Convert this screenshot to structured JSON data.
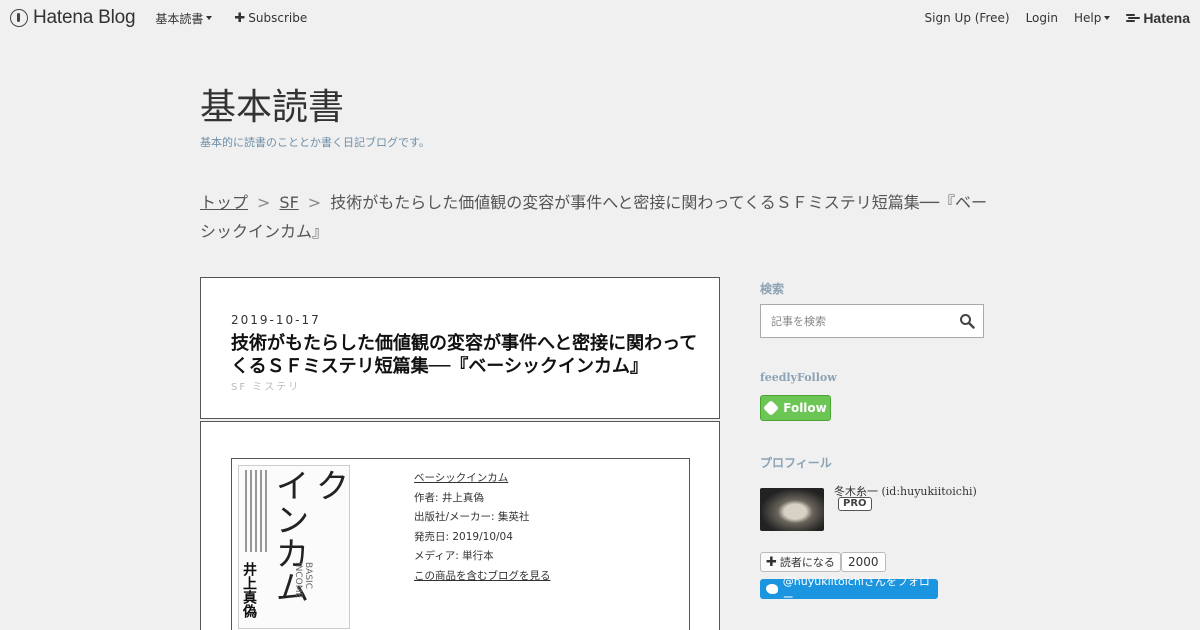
{
  "topbar": {
    "brand": "Hatena Blog",
    "nav": [
      {
        "label": "基本読書",
        "has_caret": true
      },
      {
        "label": "Subscribe",
        "has_plus": true
      }
    ],
    "right": {
      "signup": "Sign Up (Free)",
      "login": "Login",
      "help": "Help",
      "hatena": "Hatena"
    }
  },
  "blog": {
    "title": "基本読書",
    "description": "基本的に読書のこととか書く日記ブログです。"
  },
  "breadcrumb": {
    "items": [
      "トップ",
      "SF"
    ],
    "separator": ">",
    "current": "技術がもたらした価値観の変容が事件へと密接に関わってくるＳＦミステリ短篇集──『ベーシックインカム』"
  },
  "entry": {
    "date": "2019-10-17",
    "title": "技術がもたらした価値観の変容が事件へと密接に関わってくるＳＦミステリ短篇集──『ベーシックインカム』",
    "categories": [
      "SF",
      "ミステリ"
    ]
  },
  "product": {
    "title": "ベーシックインカム",
    "author": "作者: 井上真偽",
    "publisher": "出版社/メーカー: 集英社",
    "release": "発売日: 2019/10/04",
    "media": "メディア: 単行本",
    "blog_link": "この商品を含むブログを見る",
    "cover": {
      "title_line1": "ベーシック",
      "title_line2": "インカム",
      "author": "井上真偽",
      "english": "BASIC INCOME"
    }
  },
  "sidebar": {
    "search": {
      "heading": "検索",
      "placeholder": "記事を検索",
      "icon": "search-icon"
    },
    "feedly": {
      "heading": "feedlyFollow",
      "button": "Follow",
      "color": "#6cc655"
    },
    "profile": {
      "heading": "プロフィール",
      "name": "冬木糸一 (id:huyukiitoichi)",
      "badge": "PRO",
      "reader_button": "読者になる",
      "reader_count": "2000",
      "twitter_button": "@huyukiitoichiさんをフォロー"
    }
  },
  "colors": {
    "background": "#f0f0f0",
    "accent_blue": "#6e8fa8",
    "twitter": "#1b95e0"
  }
}
